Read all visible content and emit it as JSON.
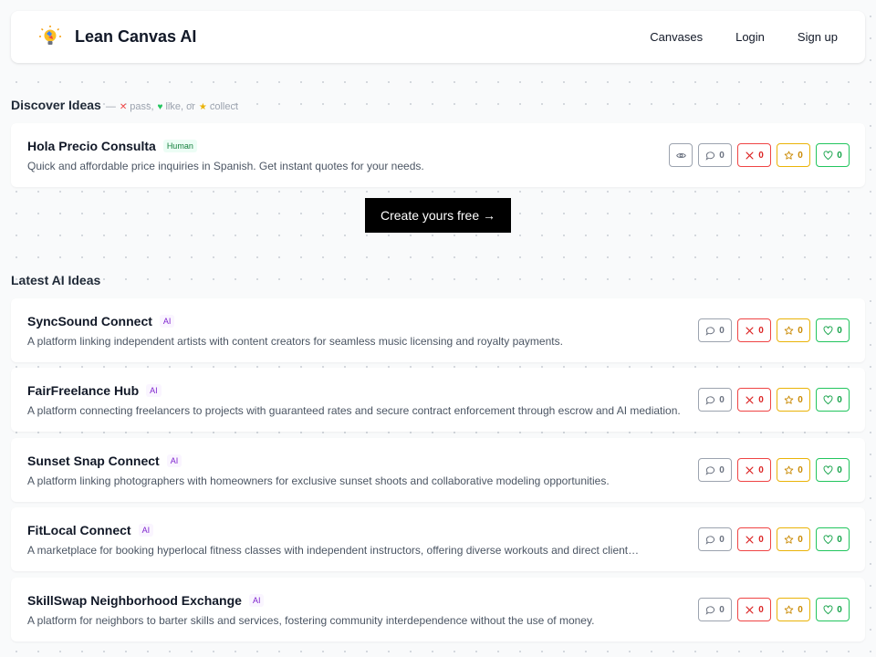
{
  "nav": {
    "brand": "Lean Canvas AI",
    "links": [
      "Canvases",
      "Login",
      "Sign up"
    ]
  },
  "discover": {
    "title": "Discover Ideas",
    "legend": {
      "prefix": "—",
      "pass": "pass,",
      "like": "like, or",
      "collect": "collect"
    },
    "card": {
      "title": "Hola Precio Consulta",
      "tag": "Human",
      "desc": "Quick and affordable price inquiries in Spanish. Get instant quotes for your needs.",
      "comments": "0",
      "passes": "0",
      "collects": "0",
      "likes": "0"
    }
  },
  "cta": {
    "label": "Create yours free →"
  },
  "latest": {
    "title": "Latest AI Ideas",
    "cards": [
      {
        "title": "SyncSound Connect",
        "tag": "AI",
        "desc": "A platform linking independent artists with content creators for seamless music licensing and royalty payments.",
        "comments": "0",
        "passes": "0",
        "collects": "0",
        "likes": "0"
      },
      {
        "title": "FairFreelance Hub",
        "tag": "AI",
        "desc": "A platform connecting freelancers to projects with guaranteed rates and secure contract enforcement through escrow and AI mediation.",
        "comments": "0",
        "passes": "0",
        "collects": "0",
        "likes": "0"
      },
      {
        "title": "Sunset Snap Connect",
        "tag": "AI",
        "desc": "A platform linking photographers with homeowners for exclusive sunset shoots and collaborative modeling opportunities.",
        "comments": "0",
        "passes": "0",
        "collects": "0",
        "likes": "0"
      },
      {
        "title": "FitLocal Connect",
        "tag": "AI",
        "desc": "A marketplace for booking hyperlocal fitness classes with independent instructors, offering diverse workouts and direct client…",
        "comments": "0",
        "passes": "0",
        "collects": "0",
        "likes": "0"
      },
      {
        "title": "SkillSwap Neighborhood Exchange",
        "tag": "AI",
        "desc": "A platform for neighbors to barter skills and services, fostering community interdependence without the use of money.",
        "comments": "0",
        "passes": "0",
        "collects": "0",
        "likes": "0"
      }
    ]
  }
}
